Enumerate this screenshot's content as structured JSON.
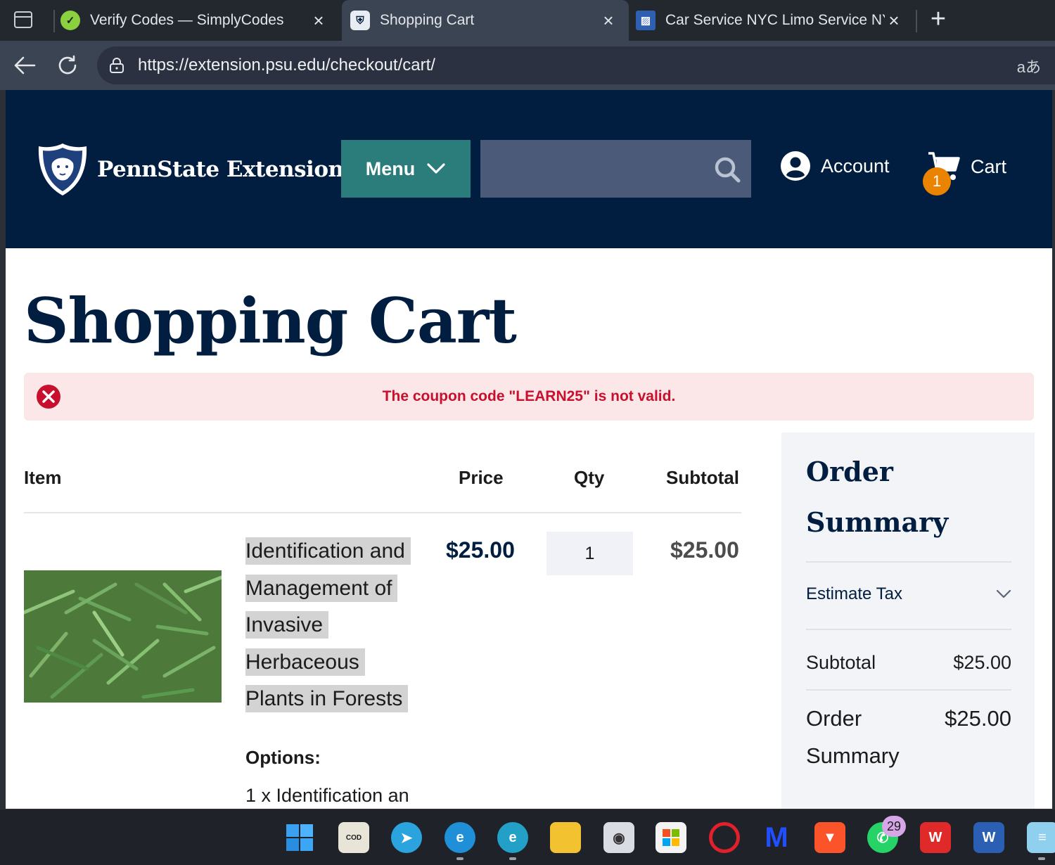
{
  "browser": {
    "tabs": [
      {
        "title": "Verify Codes — SimplyCodes",
        "icon": "simplycodes-favicon",
        "active": false
      },
      {
        "title": "Shopping Cart",
        "icon": "pennstate-favicon",
        "active": true
      },
      {
        "title": "Car Service NYC Limo Service NY (",
        "icon": "carservice-favicon",
        "active": false
      }
    ],
    "url": "https://extension.psu.edu/checkout/cart/",
    "translate_glyph": "aあ"
  },
  "site": {
    "logo_text": "PennState Extension",
    "menu_label": "Menu",
    "search_placeholder": "",
    "account_label": "Account",
    "cart_label": "Cart",
    "cart_count": "1"
  },
  "page": {
    "title": "Shopping Cart",
    "alert": "The coupon code \"LEARN25\" is not valid."
  },
  "cart": {
    "headers": {
      "item": "Item",
      "price": "Price",
      "qty": "Qty",
      "subtotal": "Subtotal"
    },
    "items": [
      {
        "name_lines": [
          "Identification and",
          "Management of",
          "Invasive",
          "Herbaceous",
          "Plants in Forests"
        ],
        "price": "$25.00",
        "qty": "1",
        "subtotal": "$25.00",
        "options_label": "Options:",
        "options_text": "1 x Identification an"
      }
    ]
  },
  "summary": {
    "title": "Order Summary",
    "estimate_tax": "Estimate Tax",
    "subtotal_label": "Subtotal",
    "subtotal_value": "$25.00",
    "total_label": "Order Summary",
    "total_value": "$25.00"
  },
  "taskbar": {
    "whatsapp_badge": "29"
  },
  "colors": {
    "navy": "#011e41",
    "teal": "#2a7d7a",
    "orange_badge": "#e98300",
    "error_red": "#c8102e"
  }
}
